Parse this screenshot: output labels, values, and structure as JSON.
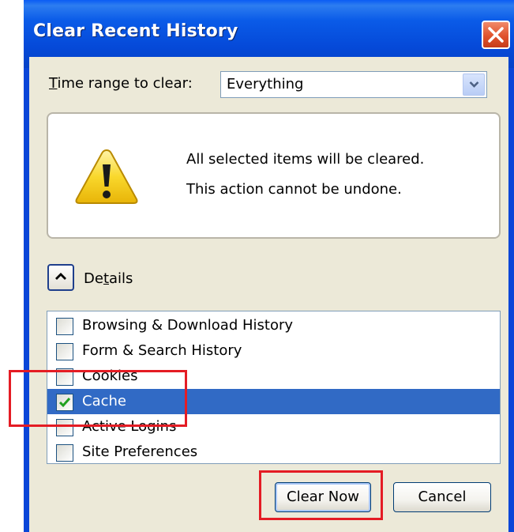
{
  "dialog": {
    "title": "Clear Recent History"
  },
  "time_range": {
    "label": "Time range to clear:",
    "selected_value": "Everything"
  },
  "warning": {
    "line1": "All selected items will be cleared.",
    "line2": "This action cannot be undone."
  },
  "details": {
    "label": "Details",
    "expanded": true
  },
  "items": [
    {
      "label": "Browsing & Download History",
      "checked": false,
      "selected": false
    },
    {
      "label": "Form & Search History",
      "checked": false,
      "selected": false
    },
    {
      "label": "Cookies",
      "checked": false,
      "selected": false
    },
    {
      "label": "Cache",
      "checked": true,
      "selected": true
    },
    {
      "label": "Active Logins",
      "checked": false,
      "selected": false
    },
    {
      "label": "Site Preferences",
      "checked": false,
      "selected": false
    }
  ],
  "buttons": {
    "clear_now": "Clear Now",
    "cancel": "Cancel"
  },
  "colors": {
    "titlebar": "#0a46d8",
    "selection": "#316ac5",
    "annotation": "#e41c24",
    "dialog_bg": "#ece9d8"
  }
}
